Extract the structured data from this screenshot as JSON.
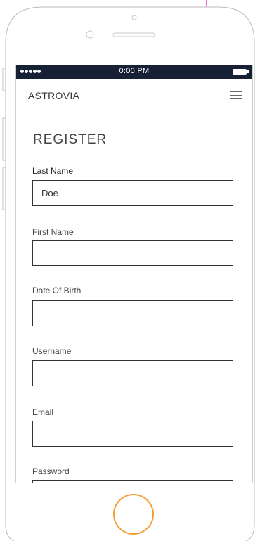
{
  "status_bar": {
    "time": "0:00 PM"
  },
  "navbar": {
    "brand": "ASTROVIA",
    "menu_icon": "hamburger-menu-icon"
  },
  "page": {
    "title": "REGISTER"
  },
  "form": {
    "last_name": {
      "label": "Last Name",
      "value": "Doe"
    },
    "first_name": {
      "label": "First Name",
      "value": ""
    },
    "date_of_birth": {
      "label": "Date Of Birth",
      "value": ""
    },
    "username": {
      "label": "Username",
      "value": ""
    },
    "email": {
      "label": "Email",
      "value": ""
    },
    "password": {
      "label": "Password",
      "value": ""
    }
  },
  "colors": {
    "status_bar": "#172035",
    "home_button": "#f0a030",
    "frame": "#bbbbbb",
    "accent_line": "#e040c0"
  }
}
